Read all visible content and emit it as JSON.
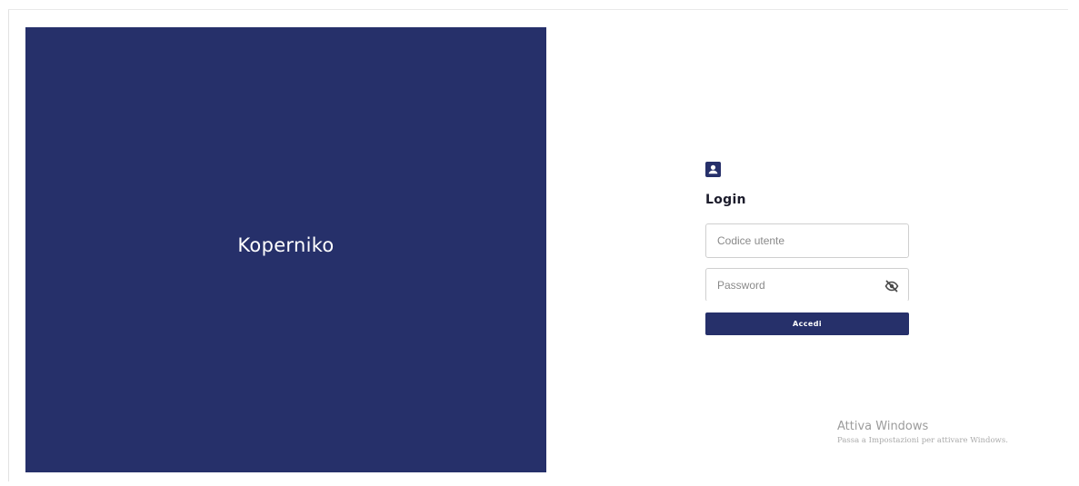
{
  "brand": {
    "name": "Koperniko",
    "panel_color": "#26306a"
  },
  "login": {
    "icon": "user-card-icon",
    "title": "Login",
    "username": {
      "placeholder": "Codice utente",
      "value": ""
    },
    "password": {
      "placeholder": "Password",
      "value": "",
      "toggle_icon": "eye-slash-icon"
    },
    "submit_label": "Accedi",
    "accent_color": "#26306a"
  },
  "watermark": {
    "title": "Attiva Windows",
    "subtitle": "Passa a Impostazioni per attivare Windows."
  }
}
